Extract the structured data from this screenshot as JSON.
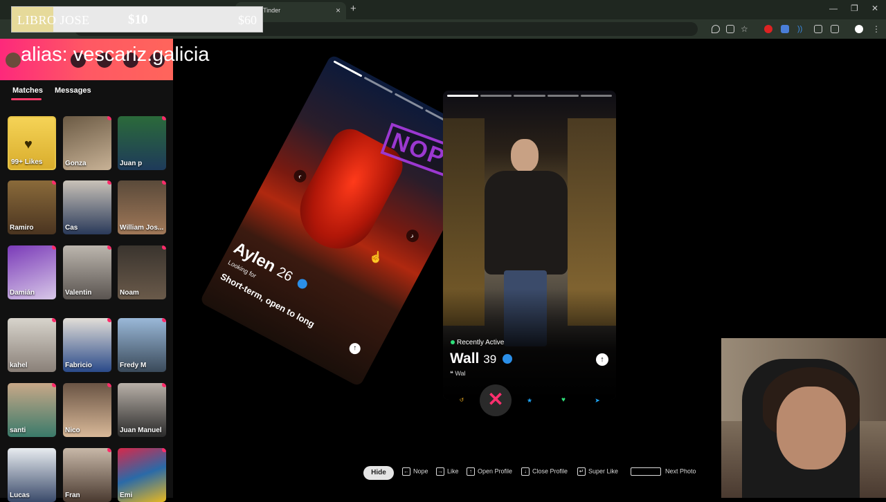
{
  "browser": {
    "tab_title": "Tinder",
    "tab_close": "×",
    "new_tab": "+",
    "minimize": "—",
    "restore": "❐",
    "close": "✕"
  },
  "overlay": {
    "label": "LIBRO JOSE",
    "current": "$10",
    "max": "$60",
    "progress_fraction": 0.166
  },
  "alias": "alias: vescariz.galicia",
  "sidebar": {
    "tabs": [
      {
        "label": "Matches",
        "active": true
      },
      {
        "label": "Messages",
        "active": false
      }
    ],
    "likes_label": "99+ Likes",
    "matches": [
      {
        "name": "Gonza"
      },
      {
        "name": "Juan p"
      },
      {
        "name": "Ramiro"
      },
      {
        "name": "Cas"
      },
      {
        "name": "William Jos..."
      },
      {
        "name": "Damián"
      },
      {
        "name": "Valentin"
      },
      {
        "name": "Noam"
      },
      {
        "name": "kahel"
      },
      {
        "name": "Fabricio"
      },
      {
        "name": "Fredy M"
      },
      {
        "name": "santi"
      },
      {
        "name": "Nico"
      },
      {
        "name": "Juan Manuel"
      },
      {
        "name": "Lucas"
      },
      {
        "name": "Fran"
      },
      {
        "name": "Emi"
      }
    ]
  },
  "card_back": {
    "stamp": "NOPE",
    "name": "Aylen",
    "age": "26",
    "looking_label": "Looking for",
    "intent": "Short-term, open to long"
  },
  "card_front": {
    "status": "Recently Active",
    "name": "Wall",
    "age": "39",
    "bio": "Wal"
  },
  "actions": {
    "rewind_icon": "↺",
    "nope_icon": "✕",
    "super_icon": "★",
    "like_icon": "♥",
    "boost_icon": "➤"
  },
  "shortcuts": {
    "hide": "Hide",
    "nope": "Nope",
    "like": "Like",
    "open_profile": "Open Profile",
    "close_profile": "Close Profile",
    "super_like": "Super Like",
    "next_photo": "Next Photo"
  },
  "colors": {
    "brand_gradient_start": "#fd297b",
    "brand_gradient_end": "#ff655b",
    "nope": "#ff2f6e",
    "like": "#2fe07a",
    "super": "#1fa8ff",
    "likes_gold": "#e8c547"
  }
}
